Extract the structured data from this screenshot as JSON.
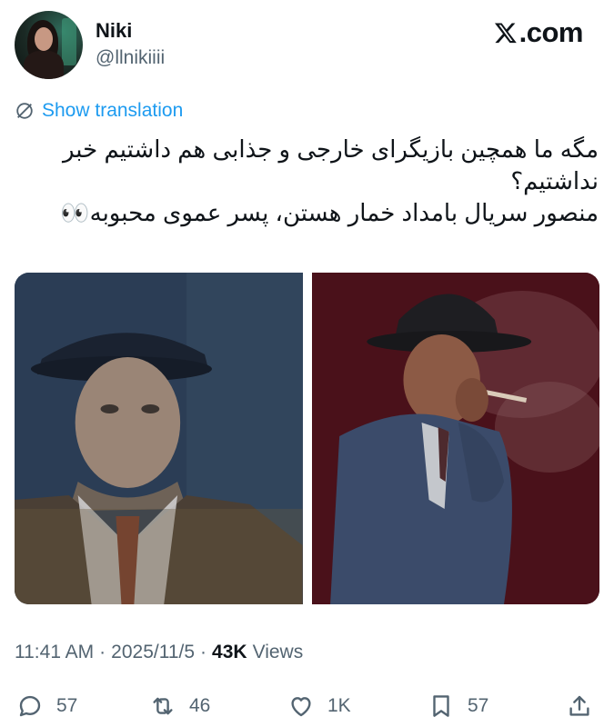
{
  "author": {
    "name": "Niki",
    "handle": "@llnikiiii",
    "avatar_icon": "profile-photo"
  },
  "brand": {
    "label": ".com",
    "icon": "x-logo-icon"
  },
  "translation": {
    "label": "Show translation",
    "icon": "globe-icon",
    "color": "#1d9bf0"
  },
  "tweet": {
    "lines": [
      "مگه ما همچین بازیگرای خارجی و جذابی هم داشتیم خبر نداشتیم؟",
      "منصور سریال بامداد خمار هستن، پسر عموی محبوبه👀"
    ]
  },
  "media": {
    "photos": [
      {
        "icon": "photo-man-in-hat-blue"
      },
      {
        "icon": "photo-man-smoking-red"
      }
    ]
  },
  "meta": {
    "time": "11:41 AM",
    "separator": "·",
    "date": "2025/11/5",
    "views_count": "43K",
    "views_label": "Views"
  },
  "actions": {
    "reply": {
      "count": "57",
      "icon": "reply-icon"
    },
    "repost": {
      "count": "46",
      "icon": "repost-icon"
    },
    "like": {
      "count": "1K",
      "icon": "heart-icon"
    },
    "bookmark": {
      "count": "57",
      "icon": "bookmark-icon"
    },
    "share": {
      "icon": "share-icon"
    }
  },
  "colors": {
    "text": "#0f1419",
    "muted": "#536471",
    "link": "#1d9bf0"
  }
}
